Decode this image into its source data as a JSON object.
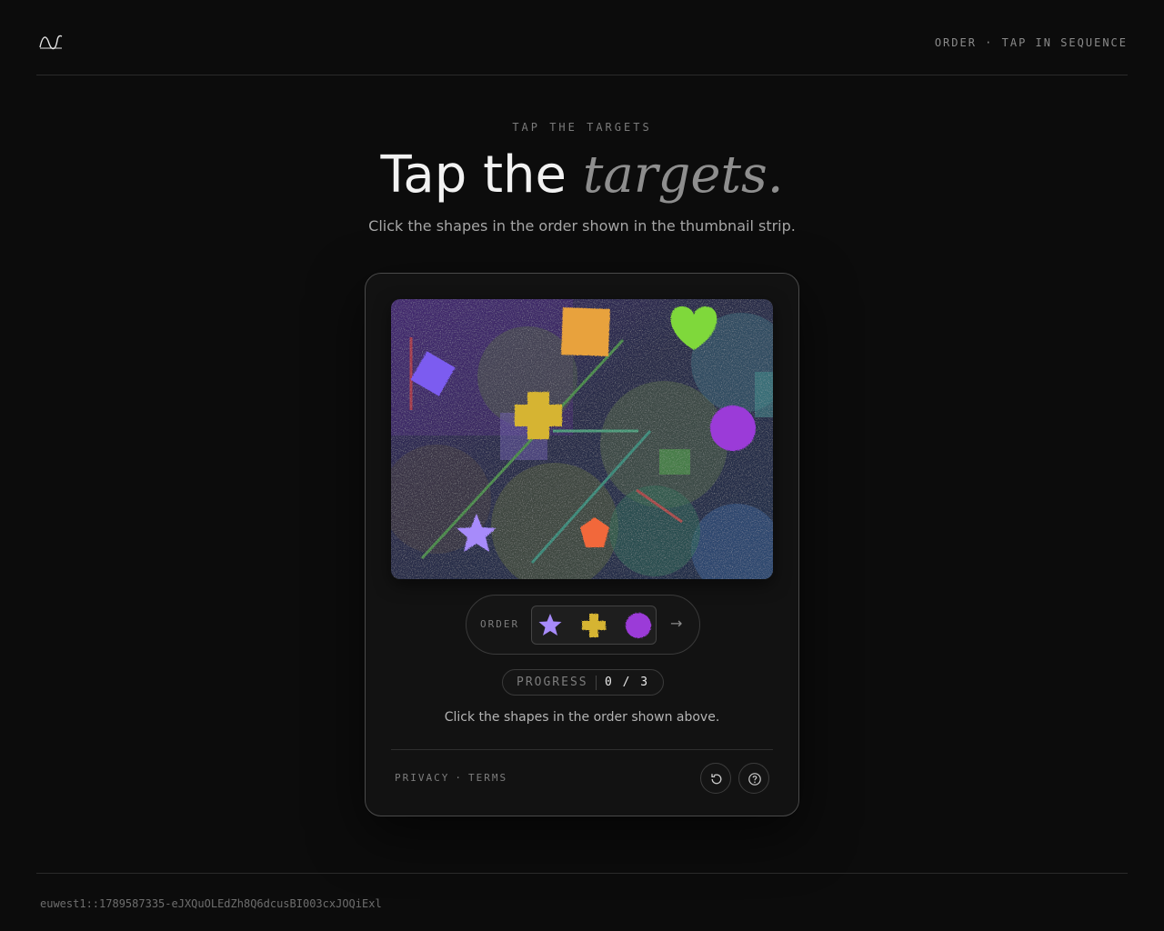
{
  "header": {
    "logo_icon": "wave-logo-icon",
    "right_text": "ORDER · TAP IN SEQUENCE"
  },
  "hero": {
    "eyebrow": "TAP THE TARGETS",
    "title_plain": "Tap the",
    "title_emphasis": "targets.",
    "subtitle": "Click the shapes in the order shown in the thumbnail strip."
  },
  "challenge": {
    "canvas_shapes": [
      {
        "name": "square",
        "color": "#e8a23c"
      },
      {
        "name": "heart",
        "color": "#7fd83a"
      },
      {
        "name": "diamond",
        "color": "#7b5cf0"
      },
      {
        "name": "cross",
        "color": "#d6b430"
      },
      {
        "name": "circle",
        "color": "#9b3ad8"
      },
      {
        "name": "star",
        "color": "#a78bfa"
      },
      {
        "name": "pentagon",
        "color": "#f2673a"
      }
    ],
    "order": {
      "label": "ORDER",
      "thumbnails": [
        {
          "name": "star",
          "color": "#a78bfa"
        },
        {
          "name": "cross",
          "color": "#d6b430"
        },
        {
          "name": "circle",
          "color": "#9b3ad8"
        }
      ],
      "arrow_icon": "arrow-right-icon",
      "arrow": "→"
    },
    "progress": {
      "label": "PROGRESS",
      "value": "0 / 3",
      "current": 0,
      "total": 3
    },
    "instruction": "Click the shapes in the order shown above."
  },
  "card_footer": {
    "privacy": "PRIVACY",
    "separator": "·",
    "terms": "TERMS",
    "reload_icon": "reload-icon",
    "help_icon": "help-icon"
  },
  "footer": {
    "session_id": "euwest1::1789587335-eJXQuOLEdZh8Q6dcusBI003cxJOQiExl"
  }
}
